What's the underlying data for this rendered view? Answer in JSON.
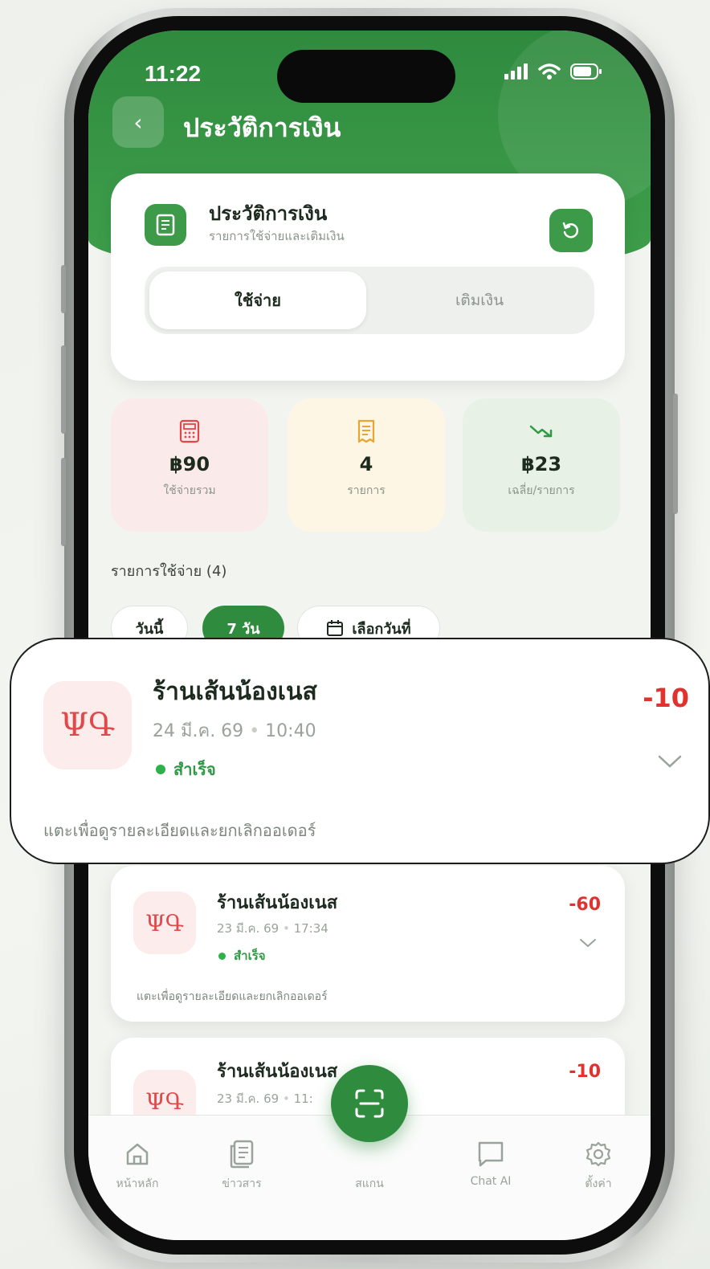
{
  "status_bar": {
    "time": "11:22"
  },
  "header": {
    "title": "ประวัติการเงิน"
  },
  "history_card": {
    "title": "ประวัติการเงิน",
    "subtitle": "รายการใช้จ่ายและเติมเงิน",
    "tabs": [
      {
        "label": "ใช้จ่าย",
        "active": true
      },
      {
        "label": "เติมเงิน",
        "active": false
      }
    ]
  },
  "stats": [
    {
      "value": "฿90",
      "label": "ใช้จ่ายรวม",
      "icon": "calculator-icon",
      "color": "#e0484a"
    },
    {
      "value": "4",
      "label": "รายการ",
      "icon": "receipt-icon",
      "color": "#e8a531"
    },
    {
      "value": "฿23",
      "label": "เฉลี่ย/รายการ",
      "icon": "trend-down-icon",
      "color": "#2e9a44"
    }
  ],
  "section": {
    "title": "รายการใช้จ่าย (4)"
  },
  "filters": [
    {
      "label": "วันนี้",
      "active": false
    },
    {
      "label": "7 วัน",
      "active": true
    },
    {
      "label": "เลือกวันที่",
      "active": false,
      "icon": "calendar-icon"
    }
  ],
  "orders": [
    {
      "name": "ร้านเส้นน้องเนส",
      "date": "24 มี.ค. 69",
      "time": "10:40",
      "status": "สำเร็จ",
      "amount": "-10",
      "hint": "แตะเพื่อดูรายละเอียดและยกเลิกออเดอร์",
      "icon_text": "ΨԳ"
    },
    {
      "name": "ร้านเส้นน้องเนส",
      "date": "23 มี.ค. 69",
      "time": "17:34",
      "status": "สำเร็จ",
      "amount": "-60",
      "hint": "แตะเพื่อดูรายละเอียดและยกเลิกออเดอร์",
      "icon_text": "ΨԳ"
    },
    {
      "name": "ร้านเส้นน้องเนส",
      "date": "23 มี.ค. 69",
      "time": "11:",
      "amount": "-10",
      "icon_text": "ΨԳ"
    }
  ],
  "bottom_nav": [
    {
      "label": "หน้าหลัก",
      "icon": "home-icon"
    },
    {
      "label": "ข่าวสาร",
      "icon": "news-icon"
    },
    {
      "label": "สแกน",
      "icon": "scan-icon"
    },
    {
      "label": "Chat AI",
      "icon": "chat-icon"
    },
    {
      "label": "ตั้งค่า",
      "icon": "settings-icon"
    }
  ],
  "colors": {
    "brand_green": "#2f8a3e",
    "danger_red": "#e0332f",
    "success_green": "#2e9a44"
  }
}
